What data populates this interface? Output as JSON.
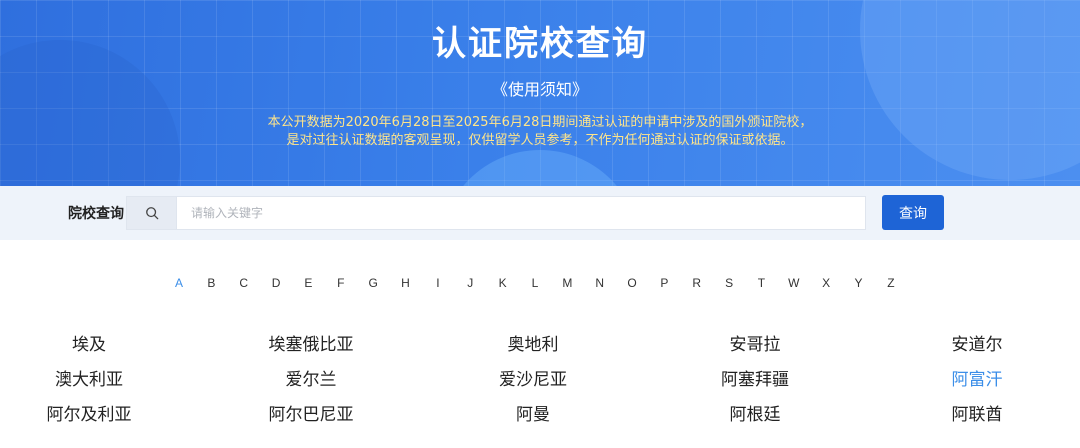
{
  "hero": {
    "title": "认证院校查询",
    "subtitle": "《使用须知》",
    "note_line1": "本公开数据为2020年6月28日至2025年6月28日期间通过认证的申请中涉及的国外颁证院校，",
    "note_line2": "是对过往认证数据的客观呈现，仅供留学人员参考，不作为任何通过认证的保证或依据。"
  },
  "search": {
    "label": "院校查询",
    "icon": "search-icon",
    "placeholder": "请输入关键字",
    "value": "",
    "button_label": "查询",
    "button_color": "#1e64d6"
  },
  "alphabet": {
    "active": "A",
    "active_color": "#3b8ee8",
    "letters": [
      "A",
      "B",
      "C",
      "D",
      "E",
      "F",
      "G",
      "H",
      "I",
      "J",
      "K",
      "L",
      "M",
      "N",
      "O",
      "P",
      "R",
      "S",
      "T",
      "W",
      "X",
      "Y",
      "Z"
    ]
  },
  "countries": [
    [
      "埃及",
      "埃塞俄比亚",
      "奥地利",
      "安哥拉",
      "安道尔"
    ],
    [
      "澳大利亚",
      "爱尔兰",
      "爱沙尼亚",
      "阿塞拜疆",
      "阿富汗"
    ],
    [
      "阿尔及利亚",
      "阿尔巴尼亚",
      "阿曼",
      "阿根廷",
      "阿联酋"
    ]
  ],
  "highlighted_country": "阿富汗"
}
